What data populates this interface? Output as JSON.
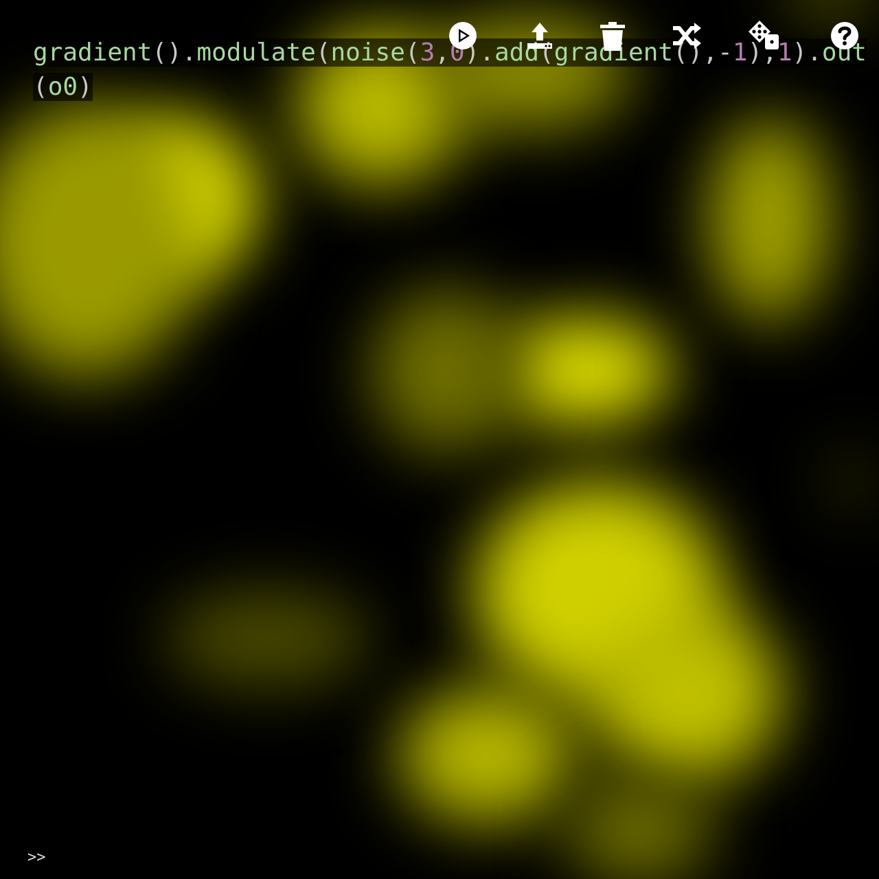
{
  "editor": {
    "code": [
      {
        "t": "gradient",
        "c": "fn"
      },
      {
        "t": "().",
        "c": "punc"
      },
      {
        "t": "modulate",
        "c": "fn"
      },
      {
        "t": "(",
        "c": "punc"
      },
      {
        "t": "noise",
        "c": "fn"
      },
      {
        "t": "(",
        "c": "punc"
      },
      {
        "t": "3",
        "c": "num"
      },
      {
        "t": ",",
        "c": "punc"
      },
      {
        "t": "0",
        "c": "num"
      },
      {
        "t": ").",
        "c": "punc"
      },
      {
        "t": "add",
        "c": "fn"
      },
      {
        "t": "(",
        "c": "punc"
      },
      {
        "t": "gradient",
        "c": "fn"
      },
      {
        "t": "(),-",
        "c": "punc"
      },
      {
        "t": "1",
        "c": "num"
      },
      {
        "t": "),",
        "c": "punc"
      },
      {
        "t": "1",
        "c": "num"
      },
      {
        "t": ").",
        "c": "punc"
      },
      {
        "t": "out",
        "c": "fn"
      },
      {
        "t": "(",
        "c": "punc"
      },
      {
        "t": "o0",
        "c": "fn"
      },
      {
        "t": ")",
        "c": "punc"
      }
    ]
  },
  "toolbar": {
    "buttons": [
      {
        "name": "run-button",
        "icon": "play-circle-icon"
      },
      {
        "name": "upload-button",
        "icon": "upload-icon"
      },
      {
        "name": "clear-button",
        "icon": "trash-icon"
      },
      {
        "name": "shuffle-button",
        "icon": "shuffle-icon"
      },
      {
        "name": "random-button",
        "icon": "dice-icon"
      },
      {
        "name": "help-button",
        "icon": "question-circle-icon"
      }
    ]
  },
  "console": {
    "prompt": ">>"
  },
  "colors": {
    "background": "#000000",
    "output_yellow": "#e0e000",
    "code_text": "#a8d8a0",
    "code_number": "#b57fb0"
  }
}
